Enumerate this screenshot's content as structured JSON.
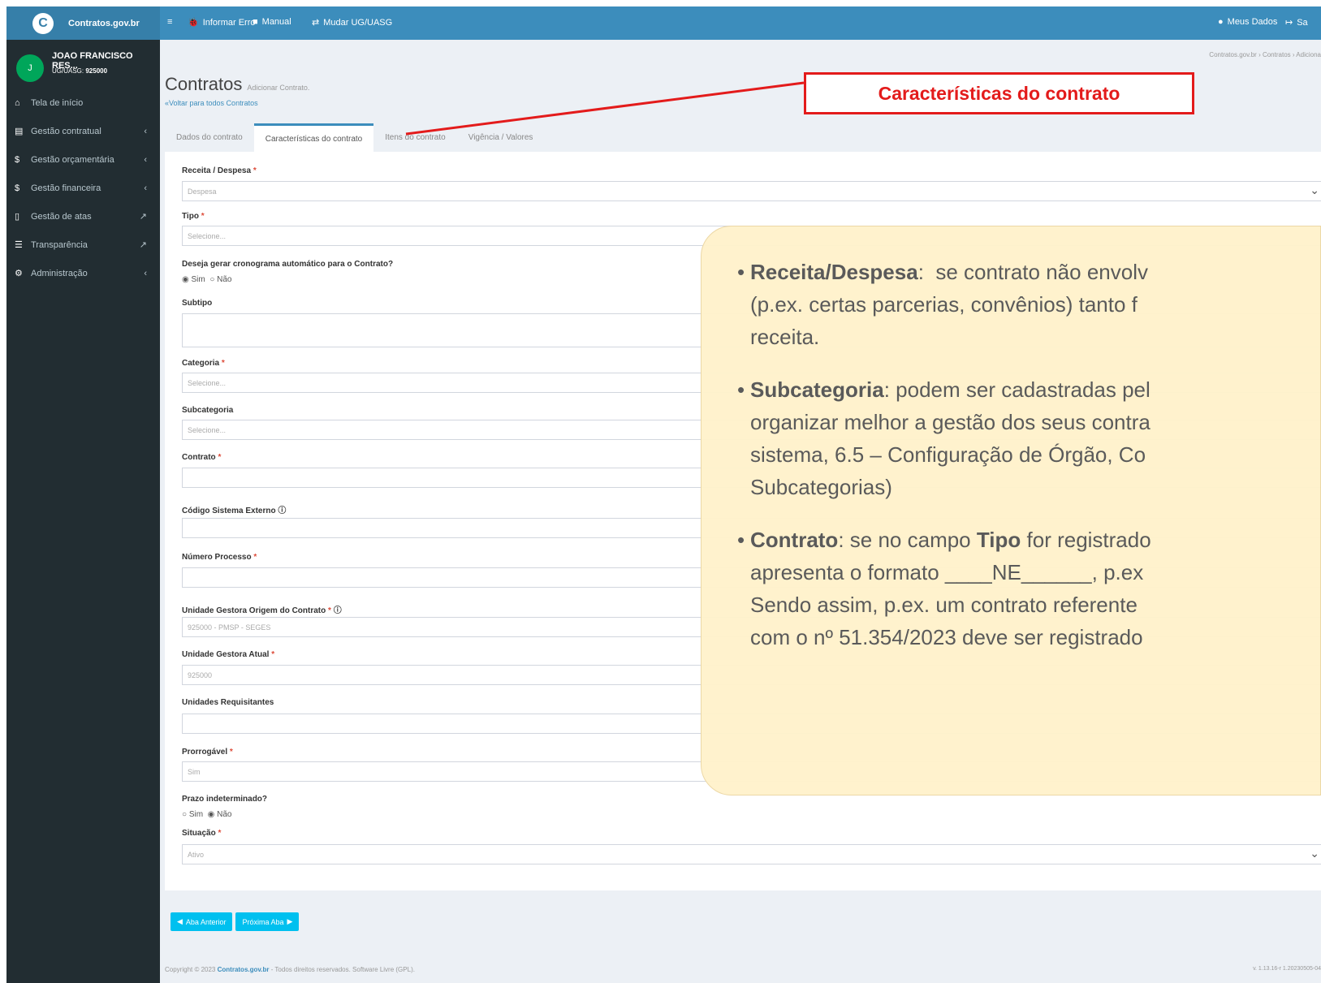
{
  "app": {
    "brand": "Contratos.gov.br"
  },
  "topbar": {
    "report": "Informar Erro",
    "manual": "Manual",
    "change_ug": "Mudar UG/UASG",
    "my_data": "Meus Dados",
    "logout": "Sa"
  },
  "user": {
    "initial": "J",
    "name": "JOAO FRANCISCO RES...",
    "ug_label": "UG/UASG:",
    "ug_code": "925000"
  },
  "sidebar": {
    "items": [
      {
        "label": "Tela de início"
      },
      {
        "label": "Gestão contratual"
      },
      {
        "label": "Gestão orçamentária"
      },
      {
        "label": "Gestão financeira"
      },
      {
        "label": "Gestão de atas"
      },
      {
        "label": "Transparência"
      },
      {
        "label": "Administração"
      }
    ]
  },
  "breadcrumb": "Contratos.gov.br  ›  Contratos  ›  Adiciona",
  "page": {
    "title": "Contratos",
    "subtitle": "Adicionar Contrato.",
    "back": "Voltar para todos Contratos"
  },
  "tabs": [
    {
      "label": "Dados do contrato"
    },
    {
      "label": "Características do contrato"
    },
    {
      "label": "Itens do contrato"
    },
    {
      "label": "Vigência / Valores"
    }
  ],
  "form": {
    "receita": {
      "label": "Receita / Despesa",
      "value": "Despesa"
    },
    "tipo": {
      "label": "Tipo",
      "placeholder": "Selecione..."
    },
    "cronograma": {
      "label": "Deseja gerar cronograma automático para o Contrato?",
      "opt_yes": "Sim",
      "opt_no": "Não"
    },
    "subtipo": {
      "label": "Subtipo"
    },
    "categoria": {
      "label": "Categoria",
      "placeholder": "Selecione..."
    },
    "subcategoria": {
      "label": "Subcategoria",
      "placeholder": "Selecione..."
    },
    "contrato": {
      "label": "Contrato"
    },
    "codigo_externo": {
      "label": "Código Sistema Externo"
    },
    "numero_processo": {
      "label": "Número Processo"
    },
    "ug_origem": {
      "label": "Unidade Gestora Origem do Contrato",
      "value": "925000 - PMSP - SEGES"
    },
    "ug_atual": {
      "label": "Unidade Gestora Atual",
      "value": "925000"
    },
    "requisitantes": {
      "label": "Unidades Requisitantes"
    },
    "prorrogavel": {
      "label": "Prorrogável",
      "value": "Sim"
    },
    "prazo": {
      "label": "Prazo indeterminado?",
      "opt_yes": "Sim",
      "opt_no": "Não"
    },
    "situacao": {
      "label": "Situação",
      "value": "Ativo"
    }
  },
  "buttons": {
    "prev": "Aba Anterior",
    "next": "Próxima Aba"
  },
  "footer": {
    "copy": "Copyright © 2023",
    "brand": "Contratos.gov.br",
    "rest": " - Todos direitos reservados. Software Livre (GPL).",
    "version": "v. 1.13.16-r 1.20230505-04"
  },
  "callout": "Características do contrato",
  "note": {
    "p1_bold": "Receita/Despesa",
    "p1_text": ":  se contrato não envolv",
    "p1_l2": "(p.ex. certas parcerias, convênios) tanto f",
    "p1_l3": "receita.",
    "p2_bold": "Subcategoria",
    "p2_text": ": podem ser cadastradas pel",
    "p2_l2": "organizar melhor a gestão dos seus contra",
    "p2_l3": "sistema, 6.5 – Configuração de Órgão, Co",
    "p2_l4": "Subcategorias)",
    "p3_bold": "Contrato",
    "p3_text": ": se no campo ",
    "p3_bold2": "Tipo",
    "p3_text2": " for registrado",
    "p3_l2": "apresenta o formato ____NE______, p.ex",
    "p3_l3": "Sendo assim, p.ex. um contrato referente",
    "p3_l4": "com o nº 51.354/2023 deve ser registrado"
  },
  "colors": {
    "topbar": "#3c8dbc",
    "sidebar": "#222d32",
    "callout_border": "#e31b1b",
    "note_bg": "#fff2cc",
    "button": "#00c0ef"
  }
}
